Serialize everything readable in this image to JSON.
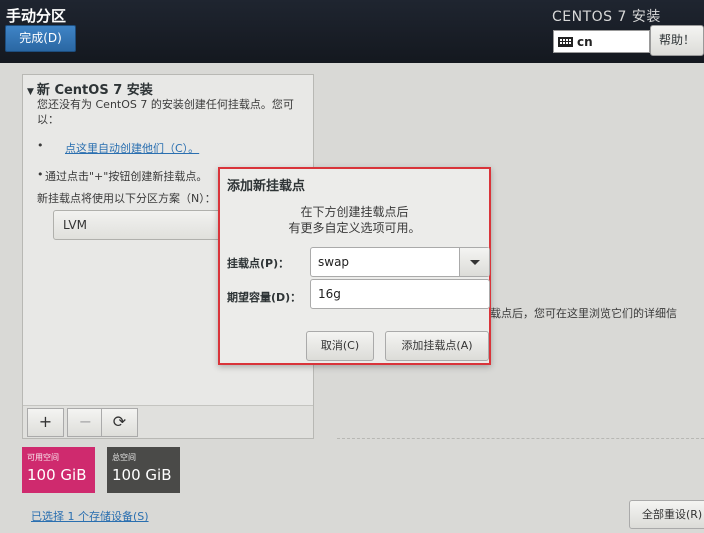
{
  "header": {
    "title": "手动分区",
    "done_label": "完成(D)",
    "product_title": "CENTOS 7 安装",
    "keyboard_layout": "cn",
    "help_label": "帮助！"
  },
  "left_panel": {
    "section_title": "新 CentOS 7 安装",
    "description": "您还没有为 CentOS 7 的安装创建任何挂载点。您可以：",
    "bullet_1": "•",
    "auto_create_link": "点这里自动创建他们（C）。",
    "bullet_2": "•",
    "manual_hint": "通过点击\"+\"按钮创建新挂载点。",
    "scheme_label": "新挂载点将使用以下分区方案（N）：",
    "scheme_value": "LVM",
    "add_label": "+",
    "remove_label": "−",
    "refresh_label": "⟳"
  },
  "space": {
    "available_label": "可用空间",
    "available_value": "100 GiB",
    "total_label": "总空间",
    "total_value": "100 GiB"
  },
  "storage_link": "已选择 1 个存储设备(S)",
  "right": {
    "info_text": "载点后，您可在这里浏览它们的详细信",
    "reset_label": "全部重设(R)"
  },
  "dialog": {
    "title": "添加新挂载点",
    "message_line_1": "在下方创建挂载点后",
    "message_line_2": "有更多自定义选项可用。",
    "mount_label": "挂载点(P)：",
    "mount_value": "swap",
    "capacity_label": "期望容量(D)：",
    "capacity_value": "16g",
    "cancel_label": "取消(C)",
    "add_label": "添加挂载点(A)",
    "highlight_color": "#d9343a"
  }
}
